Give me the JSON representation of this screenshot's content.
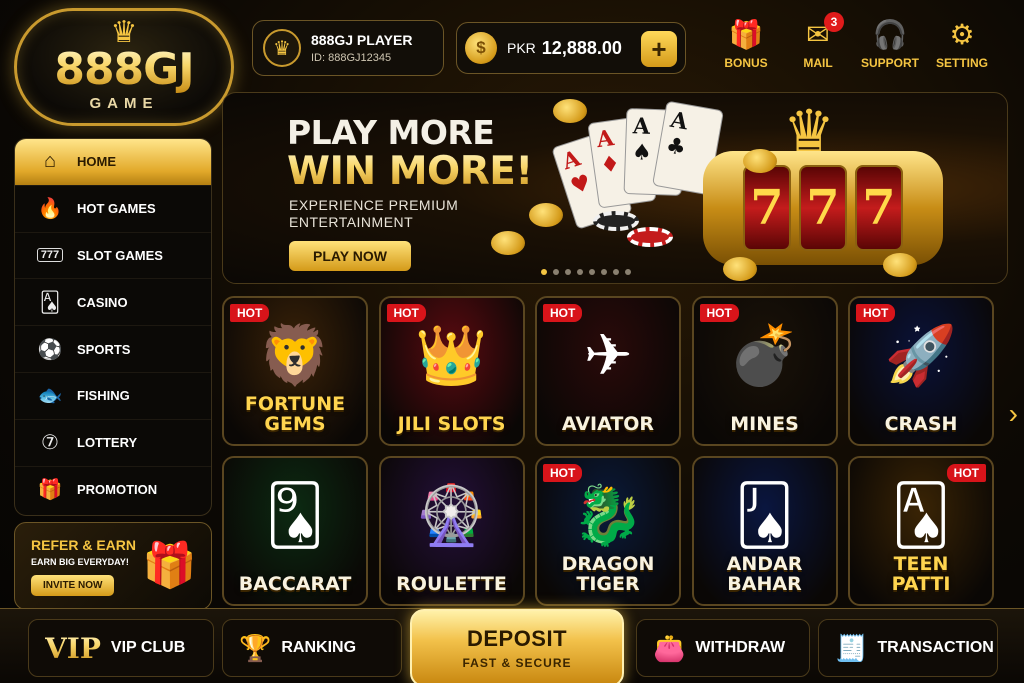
{
  "logo": {
    "main": "888GJ",
    "sub": "GAME",
    "crown_icon": "crown-icon"
  },
  "player": {
    "name": "888GJ PLAYER",
    "id": "ID: 888GJ12345",
    "avatar_icon": "crown-icon"
  },
  "balance": {
    "currency": "PKR",
    "amount": "12,888.00",
    "coin_symbol": "$",
    "add_label": "+"
  },
  "top_nav": [
    {
      "label": "BONUS",
      "icon": "gift-icon",
      "glyph": "🎁"
    },
    {
      "label": "MAIL",
      "icon": "mail-icon",
      "glyph": "✉",
      "badge": "3"
    },
    {
      "label": "SUPPORT",
      "icon": "headset-icon",
      "glyph": "🎧"
    },
    {
      "label": "SETTING",
      "icon": "gear-icon",
      "glyph": "⚙"
    }
  ],
  "sidebar": {
    "items": [
      {
        "label": "HOME",
        "icon": "home-icon",
        "glyph": "⌂",
        "active": true
      },
      {
        "label": "HOT GAMES",
        "icon": "flame-icon",
        "glyph": "🔥"
      },
      {
        "label": "SLOT GAMES",
        "icon": "slot-machine-icon",
        "glyph": "777"
      },
      {
        "label": "CASINO",
        "icon": "playing-cards-icon",
        "glyph": "🂡"
      },
      {
        "label": "SPORTS",
        "icon": "soccer-ball-icon",
        "glyph": "⚽"
      },
      {
        "label": "FISHING",
        "icon": "fish-icon",
        "glyph": "🐟"
      },
      {
        "label": "LOTTERY",
        "icon": "lottery-ball-icon",
        "glyph": "⑦"
      },
      {
        "label": "PROMOTION",
        "icon": "gift-icon",
        "glyph": "🎁"
      }
    ]
  },
  "refer": {
    "title": "REFER & EARN",
    "subtitle": "EARN BIG EVERYDAY!",
    "button": "INVITE NOW"
  },
  "banner": {
    "line1": "PLAY MORE",
    "line2": "WIN MORE!",
    "subtitle": "EXPERIENCE PREMIUM ENTERTAINMENT",
    "button": "PLAY NOW",
    "reels": [
      "7",
      "7",
      "7"
    ],
    "slides": 8,
    "active_slide": 1
  },
  "games": [
    {
      "title": "FORTUNE GEMS",
      "hot": true,
      "art": "🦁",
      "bg": "#3a2208"
    },
    {
      "title": "JILI SLOTS",
      "hot": true,
      "art": "👑",
      "bg": "#5a0a10"
    },
    {
      "title": "AVIATOR",
      "hot": true,
      "art": "✈",
      "bg": "#2a0a0a"
    },
    {
      "title": "MINES",
      "hot": true,
      "art": "💣",
      "bg": "#1a1208"
    },
    {
      "title": "CRASH",
      "hot": true,
      "art": "🚀",
      "bg": "#0a1238"
    },
    {
      "title": "BACCARAT",
      "hot": false,
      "art": "🂩",
      "bg": "#0c2a12"
    },
    {
      "title": "ROULETTE",
      "hot": false,
      "art": "🎡",
      "bg": "#24103a"
    },
    {
      "title": "DRAGON TIGER",
      "hot": true,
      "art": "🐉",
      "bg": "#0a1a3a"
    },
    {
      "title": "ANDAR BAHAR",
      "hot": false,
      "art": "🂫",
      "bg": "#0a1640"
    },
    {
      "title": "TEEN PATTI",
      "hot": true,
      "hot_right": true,
      "art": "🂡",
      "bg": "#3a2405"
    }
  ],
  "bottom_nav": {
    "vip": {
      "badge": "VIP",
      "label": "VIP CLUB",
      "icon": "crown-icon"
    },
    "ranking": {
      "label": "RANKING",
      "icon": "trophy-icon"
    },
    "deposit": {
      "label": "DEPOSIT",
      "sub": "FAST & SECURE"
    },
    "withdraw": {
      "label": "WITHDRAW",
      "icon": "wallet-icon"
    },
    "transaction": {
      "label": "TRANSACTION",
      "icon": "receipt-icon"
    }
  },
  "colors": {
    "accent": "#f5c542",
    "hot": "#d8141a",
    "bg": "#0d0904"
  }
}
